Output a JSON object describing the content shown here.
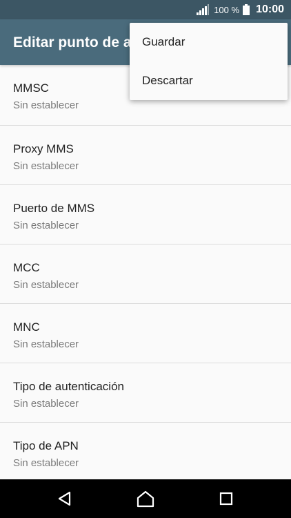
{
  "status_bar": {
    "battery_percent": "100 %",
    "time": "10:00"
  },
  "app_bar": {
    "title": "Editar punto de acceso"
  },
  "overflow_menu": {
    "items": [
      "Guardar",
      "Descartar"
    ]
  },
  "settings": [
    {
      "title": "MMSC",
      "value": "Sin establecer"
    },
    {
      "title": "Proxy MMS",
      "value": "Sin establecer"
    },
    {
      "title": "Puerto de MMS",
      "value": "Sin establecer"
    },
    {
      "title": "MCC",
      "value": "Sin establecer"
    },
    {
      "title": "MNC",
      "value": "Sin establecer"
    },
    {
      "title": "Tipo de autenticación",
      "value": "Sin establecer"
    },
    {
      "title": "Tipo de APN",
      "value": "Sin establecer"
    }
  ],
  "nav_bar": {
    "icons": [
      "back-icon",
      "home-icon",
      "recents-icon"
    ]
  },
  "colors": {
    "status_bar": "#3c5664",
    "app_bar": "#4a6b7c",
    "background": "#fafafa"
  }
}
